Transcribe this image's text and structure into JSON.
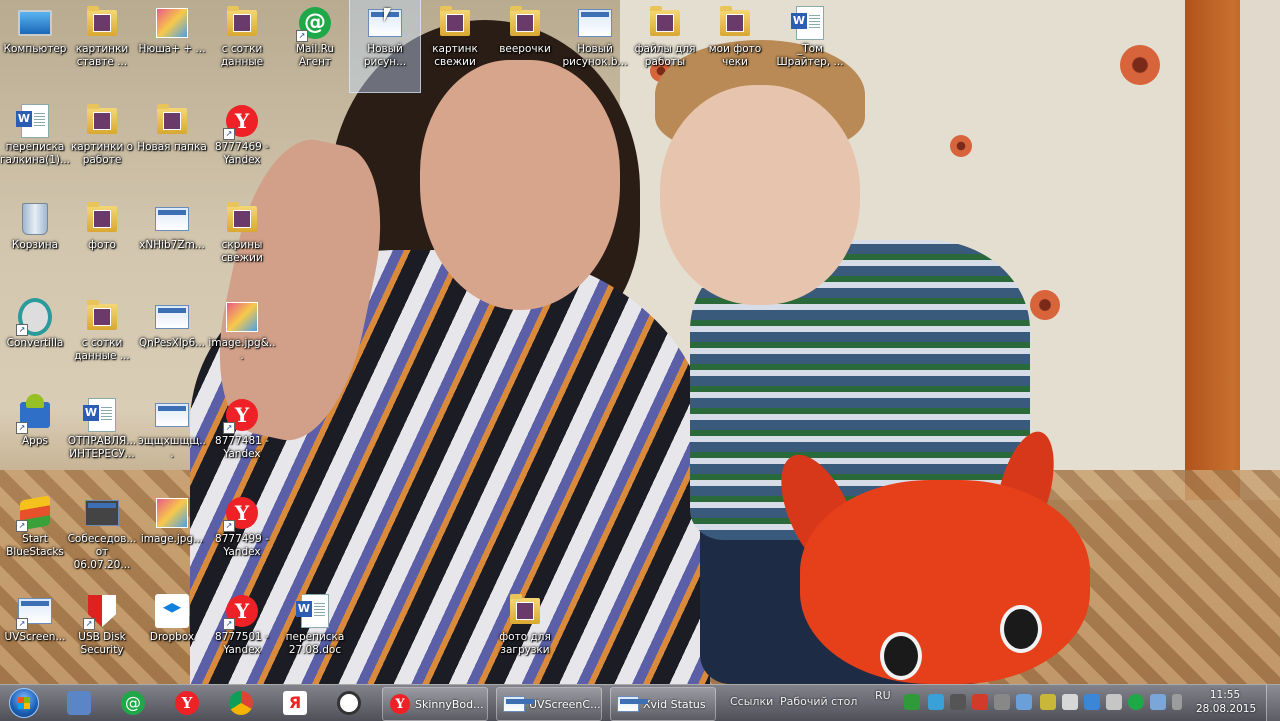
{
  "desktop": {
    "icons": [
      {
        "label": "Компьютер",
        "icon": "computer-icon"
      },
      {
        "label": "картинки ставте ...",
        "icon": "folder-icon"
      },
      {
        "label": "Нюша+ + ...",
        "icon": "image-icon"
      },
      {
        "label": "с сотки данные",
        "icon": "folder-icon"
      },
      {
        "label": "Mail.Ru Агент",
        "icon": "mailru-agent-icon"
      },
      {
        "label": "Новый рисун...",
        "icon": "paint-icon"
      },
      {
        "label": "картинк свежии",
        "icon": "folder-icon"
      },
      {
        "label": "веерочки",
        "icon": "folder-icon"
      },
      {
        "label": "Новый рисунок.b...",
        "icon": "paint-icon"
      },
      {
        "label": "файлы для работы",
        "icon": "folder-icon"
      },
      {
        "label": "мои фото чеки",
        "icon": "folder-icon"
      },
      {
        "label": "_Том Шрайтер, ...",
        "icon": "word-doc-icon"
      },
      {
        "label": "переписка галкина(1)...",
        "icon": "word-doc-icon"
      },
      {
        "label": "картинки о работе",
        "icon": "folder-icon"
      },
      {
        "label": "Новая папка",
        "icon": "folder-icon"
      },
      {
        "label": "8777469 - Yandex",
        "icon": "yandex-icon"
      },
      {
        "label": "Корзина",
        "icon": "recycle-bin-icon"
      },
      {
        "label": "фото",
        "icon": "folder-icon"
      },
      {
        "label": "xNHib7Zm...",
        "icon": "screenshot-icon"
      },
      {
        "label": "скрины свежии",
        "icon": "folder-icon"
      },
      {
        "label": "Convertilla",
        "icon": "convertilla-icon"
      },
      {
        "label": "с сотки данные ...",
        "icon": "folder-icon"
      },
      {
        "label": "QnPesXlp6...",
        "icon": "screenshot-icon"
      },
      {
        "label": "image.jpg&...",
        "icon": "image-icon"
      },
      {
        "label": "Apps",
        "icon": "android-apps-icon"
      },
      {
        "label": "ОТПРАВЛЯ... ИНТЕРЕСУ...",
        "icon": "word-doc-icon"
      },
      {
        "label": "эщщхшщщ...",
        "icon": "screenshot-icon"
      },
      {
        "label": "8777481 - Yandex",
        "icon": "yandex-icon"
      },
      {
        "label": "Start BlueStacks",
        "icon": "bluestacks-icon"
      },
      {
        "label": "Собеседов... от 06.07.20...",
        "icon": "document-icon"
      },
      {
        "label": "image.jpg...",
        "icon": "image-icon"
      },
      {
        "label": "8777499 - Yandex",
        "icon": "yandex-icon"
      },
      {
        "label": "UVScreen...",
        "icon": "uvscreencamera-icon"
      },
      {
        "label": "USB Disk Security",
        "icon": "usb-disk-security-icon"
      },
      {
        "label": "Dropbox",
        "icon": "dropbox-icon"
      },
      {
        "label": "8777501 - Yandex",
        "icon": "yandex-icon"
      },
      {
        "label": "переписка 27.08.doc",
        "icon": "word-doc-icon"
      },
      {
        "label": "фото для загрузки",
        "icon": "folder-icon"
      }
    ]
  },
  "taskbar": {
    "tasks": [
      {
        "label": "SkinnyBod...",
        "icon": "yandex-icon"
      },
      {
        "label": "UVScreenC...",
        "icon": "uvscreencamera-icon"
      },
      {
        "label": "Xvid Status",
        "icon": "xvid-icon"
      }
    ],
    "toolbar_links": "Ссылки",
    "toolbar_desktop": "Рабочий стол",
    "language": "RU",
    "time": "11:55",
    "date": "28.08.2015"
  }
}
